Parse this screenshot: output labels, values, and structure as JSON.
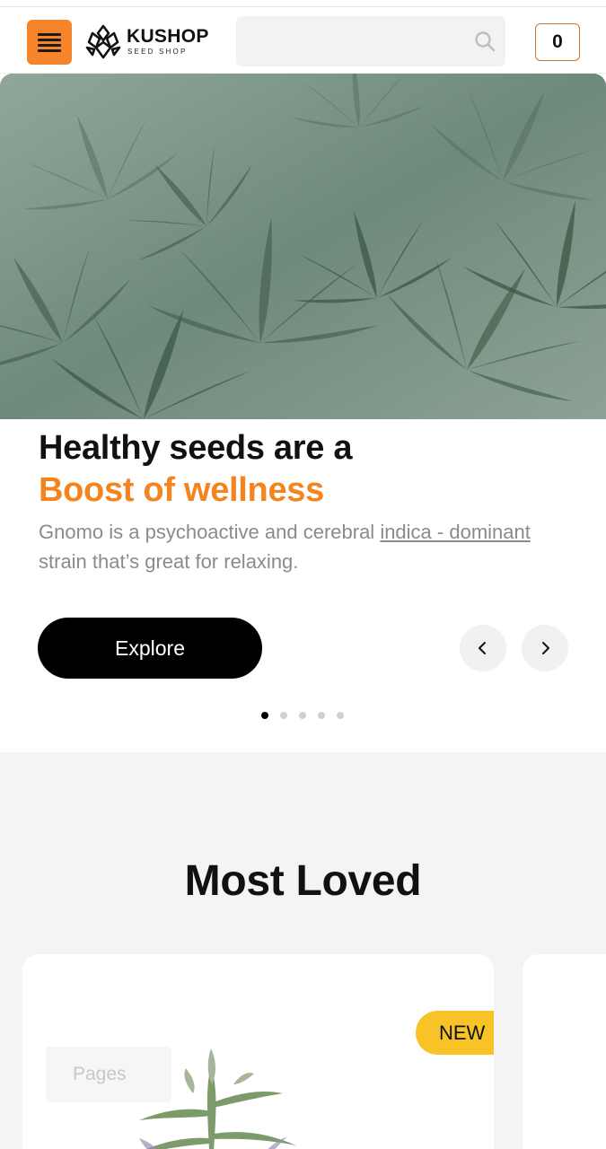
{
  "header": {
    "logo_title": "KUSHOP",
    "logo_subtitle": "SEED SHOP",
    "search_placeholder": "",
    "cart_count": "0",
    "accent_color": "#f5842a"
  },
  "hero": {
    "headline_line1": "Healthy seeds are a",
    "headline_line2": "Boost of wellness",
    "description_before": "Gnomo is a psychoactive and cerebral ",
    "description_link": "indica - dominant",
    "description_after": " strain that’s great for relaxing.",
    "cta_label": "Explore",
    "prev_icon": "‹",
    "next_icon": "›",
    "slides_total": 5,
    "slide_active": 1,
    "highlight_color": "#f5841f"
  },
  "most_loved": {
    "title": "Most Loved",
    "card": {
      "badge": "NEW",
      "overlay_chip": "Pages"
    }
  }
}
